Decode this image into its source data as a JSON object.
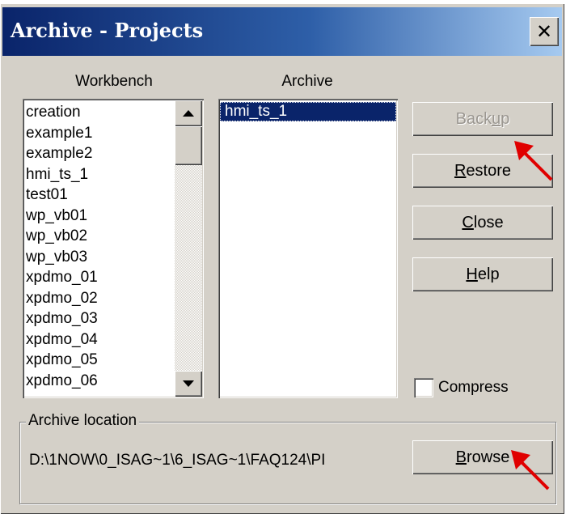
{
  "window": {
    "title": "Archive - Projects",
    "close_glyph": "✕"
  },
  "workbench": {
    "label": "Workbench",
    "items": [
      "creation",
      "example1",
      "example2",
      "hmi_ts_1",
      "test01",
      "wp_vb01",
      "wp_vb02",
      "wp_vb03",
      "xpdmo_01",
      "xpdmo_02",
      "xpdmo_03",
      "xpdmo_04",
      "xpdmo_05",
      "xpdmo_06"
    ]
  },
  "archive": {
    "label": "Archive",
    "items": [
      "hmi_ts_1"
    ],
    "selected": "hmi_ts_1"
  },
  "buttons": {
    "backup": {
      "pre": "Back",
      "acc": "u",
      "post": "p",
      "enabled": false
    },
    "restore": {
      "pre": "",
      "acc": "R",
      "post": "estore",
      "enabled": true
    },
    "close": {
      "pre": "",
      "acc": "C",
      "post": "lose",
      "enabled": true
    },
    "help": {
      "pre": "",
      "acc": "H",
      "post": "elp",
      "enabled": true
    },
    "browse": {
      "pre": "",
      "acc": "B",
      "post": "rowse",
      "enabled": true
    }
  },
  "compress": {
    "label": "Compress",
    "checked": false
  },
  "archive_location": {
    "legend": "Archive location",
    "path": "D:\\1NOW\\0_ISAG~1\\6_ISAG~1\\FAQ124\\PI"
  },
  "colors": {
    "title_start": "#0a246a",
    "title_end": "#a6caf0",
    "face": "#d4d0c8",
    "selection": "#0a246a",
    "annotation_arrow": "#e00000"
  }
}
